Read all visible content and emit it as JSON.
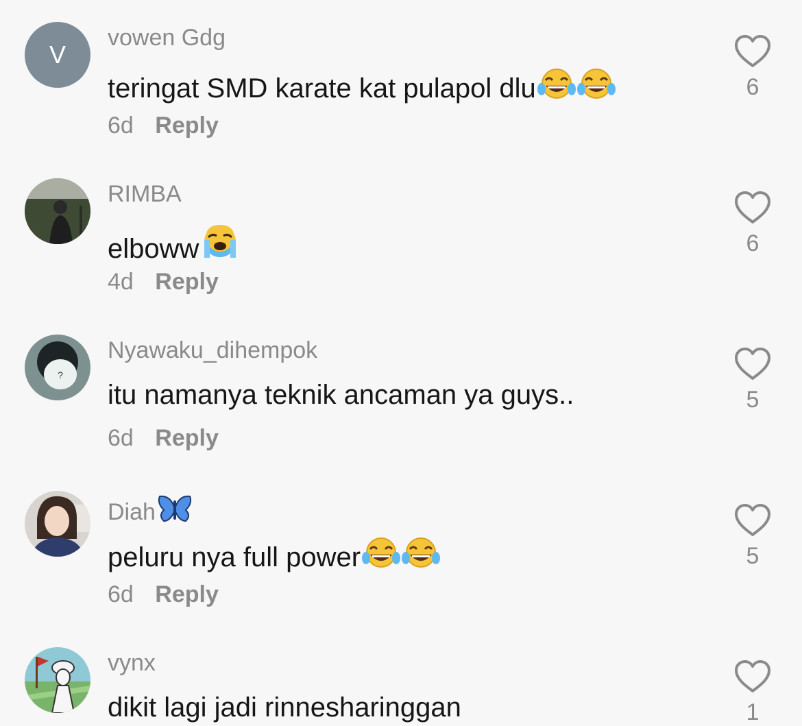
{
  "comments": [
    {
      "avatar_letter": "V",
      "username": "vowen Gdg",
      "text": "teringat SMD karate kat pulapol dlu",
      "text_emojis": [
        "laughing-tears-emoji",
        "laughing-tears-emoji"
      ],
      "time": "6d",
      "reply_label": "Reply",
      "likes": "6"
    },
    {
      "username": "RIMBA",
      "text": "elboww",
      "text_emojis": [
        "crying-emoji"
      ],
      "time": "4d",
      "reply_label": "Reply",
      "likes": "6"
    },
    {
      "username": "Nyawaku_dihempok",
      "text": "itu namanya teknik ancaman ya guys..",
      "time": "6d",
      "reply_label": "Reply",
      "likes": "5"
    },
    {
      "username": "Diah",
      "username_emoji": "butterfly-emoji",
      "text": "peluru nya full power",
      "text_emojis": [
        "laughing-tears-emoji",
        "laughing-tears-emoji"
      ],
      "time": "6d",
      "reply_label": "Reply",
      "likes": "5"
    },
    {
      "username": "vynx",
      "text": "dikit lagi jadi rinnesharinggan",
      "time": "",
      "reply_label": "",
      "likes": "1"
    }
  ],
  "colors": {
    "background": "#f7f7f7",
    "username": "#8a8a8a",
    "text": "#161616",
    "heart_outline": "#8a8a8a",
    "letter_avatar_bg": "#7d8c96"
  }
}
